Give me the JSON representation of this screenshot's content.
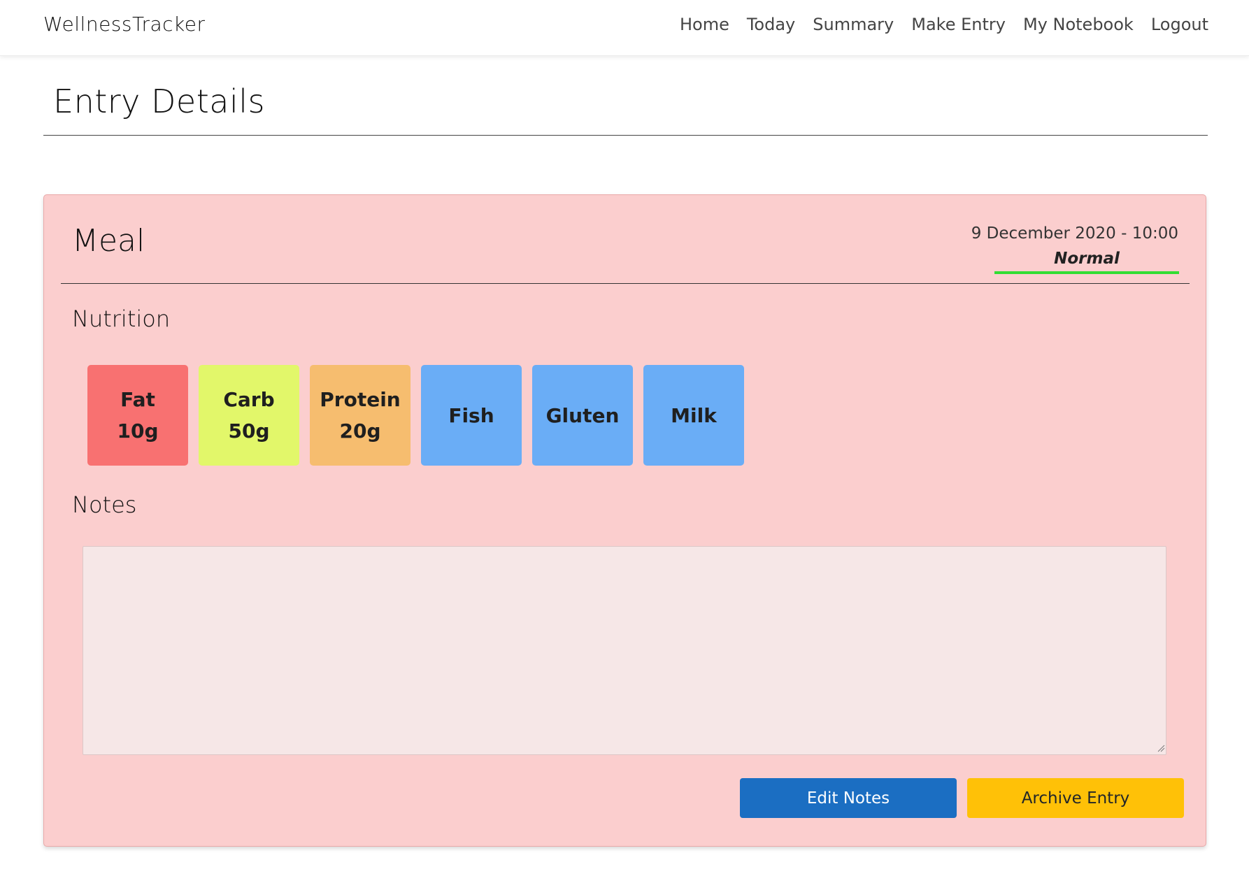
{
  "app": {
    "brand": "WellnessTracker"
  },
  "nav": {
    "items": [
      {
        "label": "Home"
      },
      {
        "label": "Today"
      },
      {
        "label": "Summary"
      },
      {
        "label": "Make Entry"
      },
      {
        "label": "My Notebook"
      },
      {
        "label": "Logout"
      }
    ]
  },
  "page": {
    "title": "Entry Details"
  },
  "entry": {
    "type": "Meal",
    "datetime": "9 December 2020 - 10:00",
    "status": "Normal",
    "status_color": "#33dd33",
    "card_color": "#fbcece",
    "nutrition_heading": "Nutrition",
    "notes_heading": "Notes",
    "notes_value": "",
    "nutrition": [
      {
        "name": "Fat",
        "amount": "10g",
        "color": "#f87171"
      },
      {
        "name": "Carb",
        "amount": "50g",
        "color": "#e2f76a"
      },
      {
        "name": "Protein",
        "amount": "20g",
        "color": "#f6bd6f"
      },
      {
        "name": "Fish",
        "amount": "",
        "color": "#6aadf6"
      },
      {
        "name": "Gluten",
        "amount": "",
        "color": "#6aadf6"
      },
      {
        "name": "Milk",
        "amount": "",
        "color": "#6aadf6"
      }
    ]
  },
  "actions": {
    "edit_label": "Edit Notes",
    "archive_label": "Archive Entry",
    "edit_color": "#1b6ec2",
    "archive_color": "#ffc107"
  }
}
